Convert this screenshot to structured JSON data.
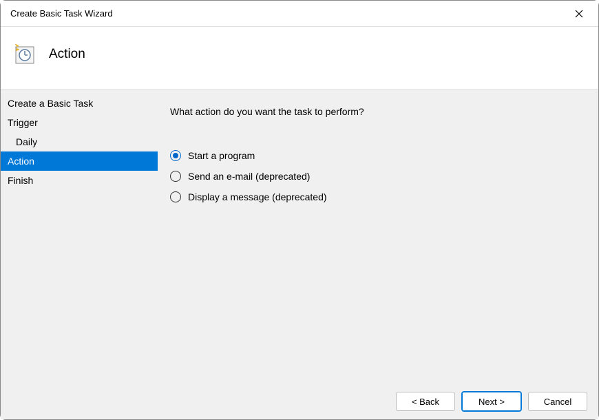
{
  "titlebar": {
    "title": "Create Basic Task Wizard"
  },
  "header": {
    "title": "Action"
  },
  "sidebar": {
    "items": [
      {
        "label": "Create a Basic Task",
        "selected": false,
        "indent": false
      },
      {
        "label": "Trigger",
        "selected": false,
        "indent": false
      },
      {
        "label": "Daily",
        "selected": false,
        "indent": true
      },
      {
        "label": "Action",
        "selected": true,
        "indent": false
      },
      {
        "label": "Finish",
        "selected": false,
        "indent": false
      }
    ]
  },
  "main": {
    "prompt": "What action do you want the task to perform?",
    "options": [
      {
        "label": "Start a program",
        "selected": true
      },
      {
        "label": "Send an e-mail (deprecated)",
        "selected": false
      },
      {
        "label": "Display a message (deprecated)",
        "selected": false
      }
    ]
  },
  "footer": {
    "back": "< Back",
    "next": "Next >",
    "cancel": "Cancel"
  }
}
